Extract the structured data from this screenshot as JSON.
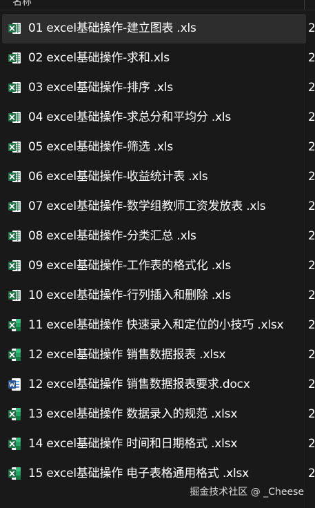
{
  "header": {
    "name_column_label": "名称"
  },
  "files": [
    {
      "name": "01 excel基础操作-建立图表 .xls",
      "type": "xls",
      "date_fragment": "2",
      "selected": true
    },
    {
      "name": "02 excel基础操作-求和.xls",
      "type": "xls",
      "date_fragment": "2",
      "selected": false
    },
    {
      "name": "03 excel基础操作-排序 .xls",
      "type": "xls",
      "date_fragment": "2",
      "selected": false
    },
    {
      "name": "04 excel基础操作-求总分和平均分 .xls",
      "type": "xls",
      "date_fragment": "2",
      "selected": false
    },
    {
      "name": "05 excel基础操作-筛选 .xls",
      "type": "xls",
      "date_fragment": "2",
      "selected": false
    },
    {
      "name": "06 excel基础操作-收益统计表 .xls",
      "type": "xls",
      "date_fragment": "2",
      "selected": false
    },
    {
      "name": "07 excel基础操作-数学组教师工资发放表 .xls",
      "type": "xls",
      "date_fragment": "2",
      "selected": false
    },
    {
      "name": "08 excel基础操作-分类汇总 .xls",
      "type": "xls",
      "date_fragment": "2",
      "selected": false
    },
    {
      "name": "09 excel基础操作-工作表的格式化 .xls",
      "type": "xls",
      "date_fragment": "2",
      "selected": false
    },
    {
      "name": "10 excel基础操作-行列插入和删除 .xls",
      "type": "xls",
      "date_fragment": "2",
      "selected": false
    },
    {
      "name": "11 excel基础操作 快速录入和定位的小技巧 .xlsx",
      "type": "xlsx",
      "date_fragment": "2",
      "selected": false
    },
    {
      "name": "12 excel基础操作 销售数据报表 .xlsx",
      "type": "xlsx",
      "date_fragment": "2",
      "selected": false
    },
    {
      "name": "12 excel基础操作 销售数据报表要求.docx",
      "type": "docx",
      "date_fragment": "2",
      "selected": false
    },
    {
      "name": "13 excel基础操作 数据录入的规范 .xlsx",
      "type": "xlsx",
      "date_fragment": "2",
      "selected": false
    },
    {
      "name": "14 excel基础操作 时间和日期格式 .xlsx",
      "type": "xlsx",
      "date_fragment": "2",
      "selected": false
    },
    {
      "name": "15 excel基础操作 电子表格通用格式 .xlsx",
      "type": "xlsx",
      "date_fragment": "2",
      "selected": false
    }
  ],
  "icons": {
    "xls": "excel-97-file-icon",
    "xlsx": "excel-file-icon",
    "docx": "word-file-icon"
  },
  "colors": {
    "background": "#191919",
    "selected_row": "#2d2d2d",
    "excel_green": "#1e7145",
    "word_blue": "#2b579a",
    "text": "#ffffff"
  },
  "watermark": "掘金技术社区 @ _Cheese"
}
